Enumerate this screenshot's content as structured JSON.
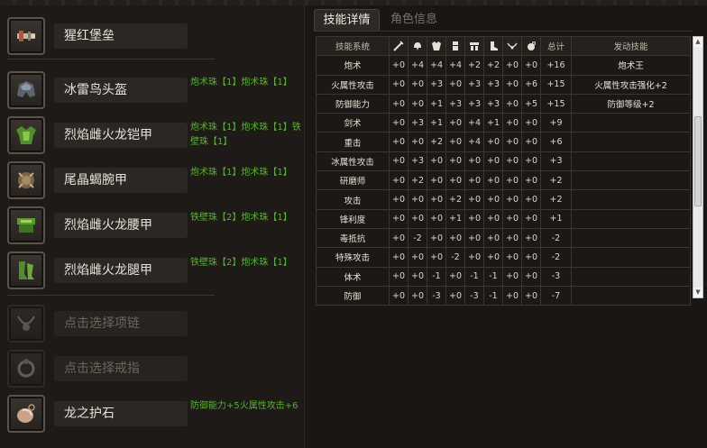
{
  "equipment": [
    {
      "name": "猩红堡垒",
      "slots": "",
      "icon": "weapon-icon",
      "placeholder": false
    },
    {
      "name": "冰雷鸟头盔",
      "slots": "炮术珠【1】炮术珠【1】",
      "icon": "helmet-icon",
      "placeholder": false
    },
    {
      "name": "烈焰雌火龙铠甲",
      "slots": "炮术珠【1】炮术珠【1】铁壁珠【1】",
      "icon": "chest-armor-icon",
      "placeholder": false
    },
    {
      "name": "尾晶蝎腕甲",
      "slots": "炮术珠【1】炮术珠【1】",
      "icon": "gauntlet-icon",
      "placeholder": false
    },
    {
      "name": "烈焰雌火龙腰甲",
      "slots": "铁壁珠【2】炮术珠【1】",
      "icon": "waist-armor-icon",
      "placeholder": false
    },
    {
      "name": "烈焰雌火龙腿甲",
      "slots": "铁壁珠【2】炮术珠【1】",
      "icon": "leg-armor-icon",
      "placeholder": false
    },
    {
      "name": "点击选择项链",
      "slots": "",
      "icon": "necklace-icon",
      "placeholder": true
    },
    {
      "name": "点击选择戒指",
      "slots": "",
      "icon": "ring-icon",
      "placeholder": true
    },
    {
      "name": "龙之护石",
      "slots": "防御能力+5火属性攻击+6",
      "icon": "charm-icon",
      "placeholder": false
    }
  ],
  "tabs": {
    "skills": "技能详情",
    "character": "角色信息"
  },
  "table": {
    "header_skill": "技能系统",
    "header_total": "总计",
    "header_trigger": "发动技能",
    "column_icons": [
      "weapon-icon",
      "helmet-icon",
      "chest-armor-icon",
      "gauntlet-icon",
      "waist-armor-icon",
      "leg-armor-icon",
      "necklace-icon",
      "charm-icon"
    ],
    "rows": [
      {
        "skill": "炮术",
        "vals": [
          "+0",
          "+4",
          "+4",
          "+4",
          "+2",
          "+2",
          "+0",
          "+0"
        ],
        "total": "+16",
        "trigger": "炮术王"
      },
      {
        "skill": "火属性攻击",
        "vals": [
          "+0",
          "+0",
          "+3",
          "+0",
          "+3",
          "+3",
          "+0",
          "+6"
        ],
        "total": "+15",
        "trigger": "火属性攻击强化+2"
      },
      {
        "skill": "防御能力",
        "vals": [
          "+0",
          "+0",
          "+1",
          "+3",
          "+3",
          "+3",
          "+0",
          "+5"
        ],
        "total": "+15",
        "trigger": "防御等级+2"
      },
      {
        "skill": "剑术",
        "vals": [
          "+0",
          "+3",
          "+1",
          "+0",
          "+4",
          "+1",
          "+0",
          "+0"
        ],
        "total": "+9",
        "trigger": ""
      },
      {
        "skill": "重击",
        "vals": [
          "+0",
          "+0",
          "+2",
          "+0",
          "+4",
          "+0",
          "+0",
          "+0"
        ],
        "total": "+6",
        "trigger": ""
      },
      {
        "skill": "冰属性攻击",
        "vals": [
          "+0",
          "+3",
          "+0",
          "+0",
          "+0",
          "+0",
          "+0",
          "+0"
        ],
        "total": "+3",
        "trigger": ""
      },
      {
        "skill": "研磨师",
        "vals": [
          "+0",
          "+2",
          "+0",
          "+0",
          "+0",
          "+0",
          "+0",
          "+0"
        ],
        "total": "+2",
        "trigger": ""
      },
      {
        "skill": "攻击",
        "vals": [
          "+0",
          "+0",
          "+0",
          "+2",
          "+0",
          "+0",
          "+0",
          "+0"
        ],
        "total": "+2",
        "trigger": ""
      },
      {
        "skill": "锋利度",
        "vals": [
          "+0",
          "+0",
          "+0",
          "+1",
          "+0",
          "+0",
          "+0",
          "+0"
        ],
        "total": "+1",
        "trigger": ""
      },
      {
        "skill": "毒抵抗",
        "vals": [
          "+0",
          "-2",
          "+0",
          "+0",
          "+0",
          "+0",
          "+0",
          "+0"
        ],
        "total": "-2",
        "trigger": ""
      },
      {
        "skill": "特殊攻击",
        "vals": [
          "+0",
          "+0",
          "+0",
          "-2",
          "+0",
          "+0",
          "+0",
          "+0"
        ],
        "total": "-2",
        "trigger": ""
      },
      {
        "skill": "体术",
        "vals": [
          "+0",
          "+0",
          "-1",
          "+0",
          "-1",
          "-1",
          "+0",
          "+0"
        ],
        "total": "-3",
        "trigger": ""
      },
      {
        "skill": "防御",
        "vals": [
          "+0",
          "+0",
          "-3",
          "+0",
          "-3",
          "-1",
          "+0",
          "+0"
        ],
        "total": "-7",
        "trigger": ""
      }
    ]
  },
  "colors": {
    "slot_text": "#58b22e",
    "panel_bg": "#1e1a17"
  }
}
